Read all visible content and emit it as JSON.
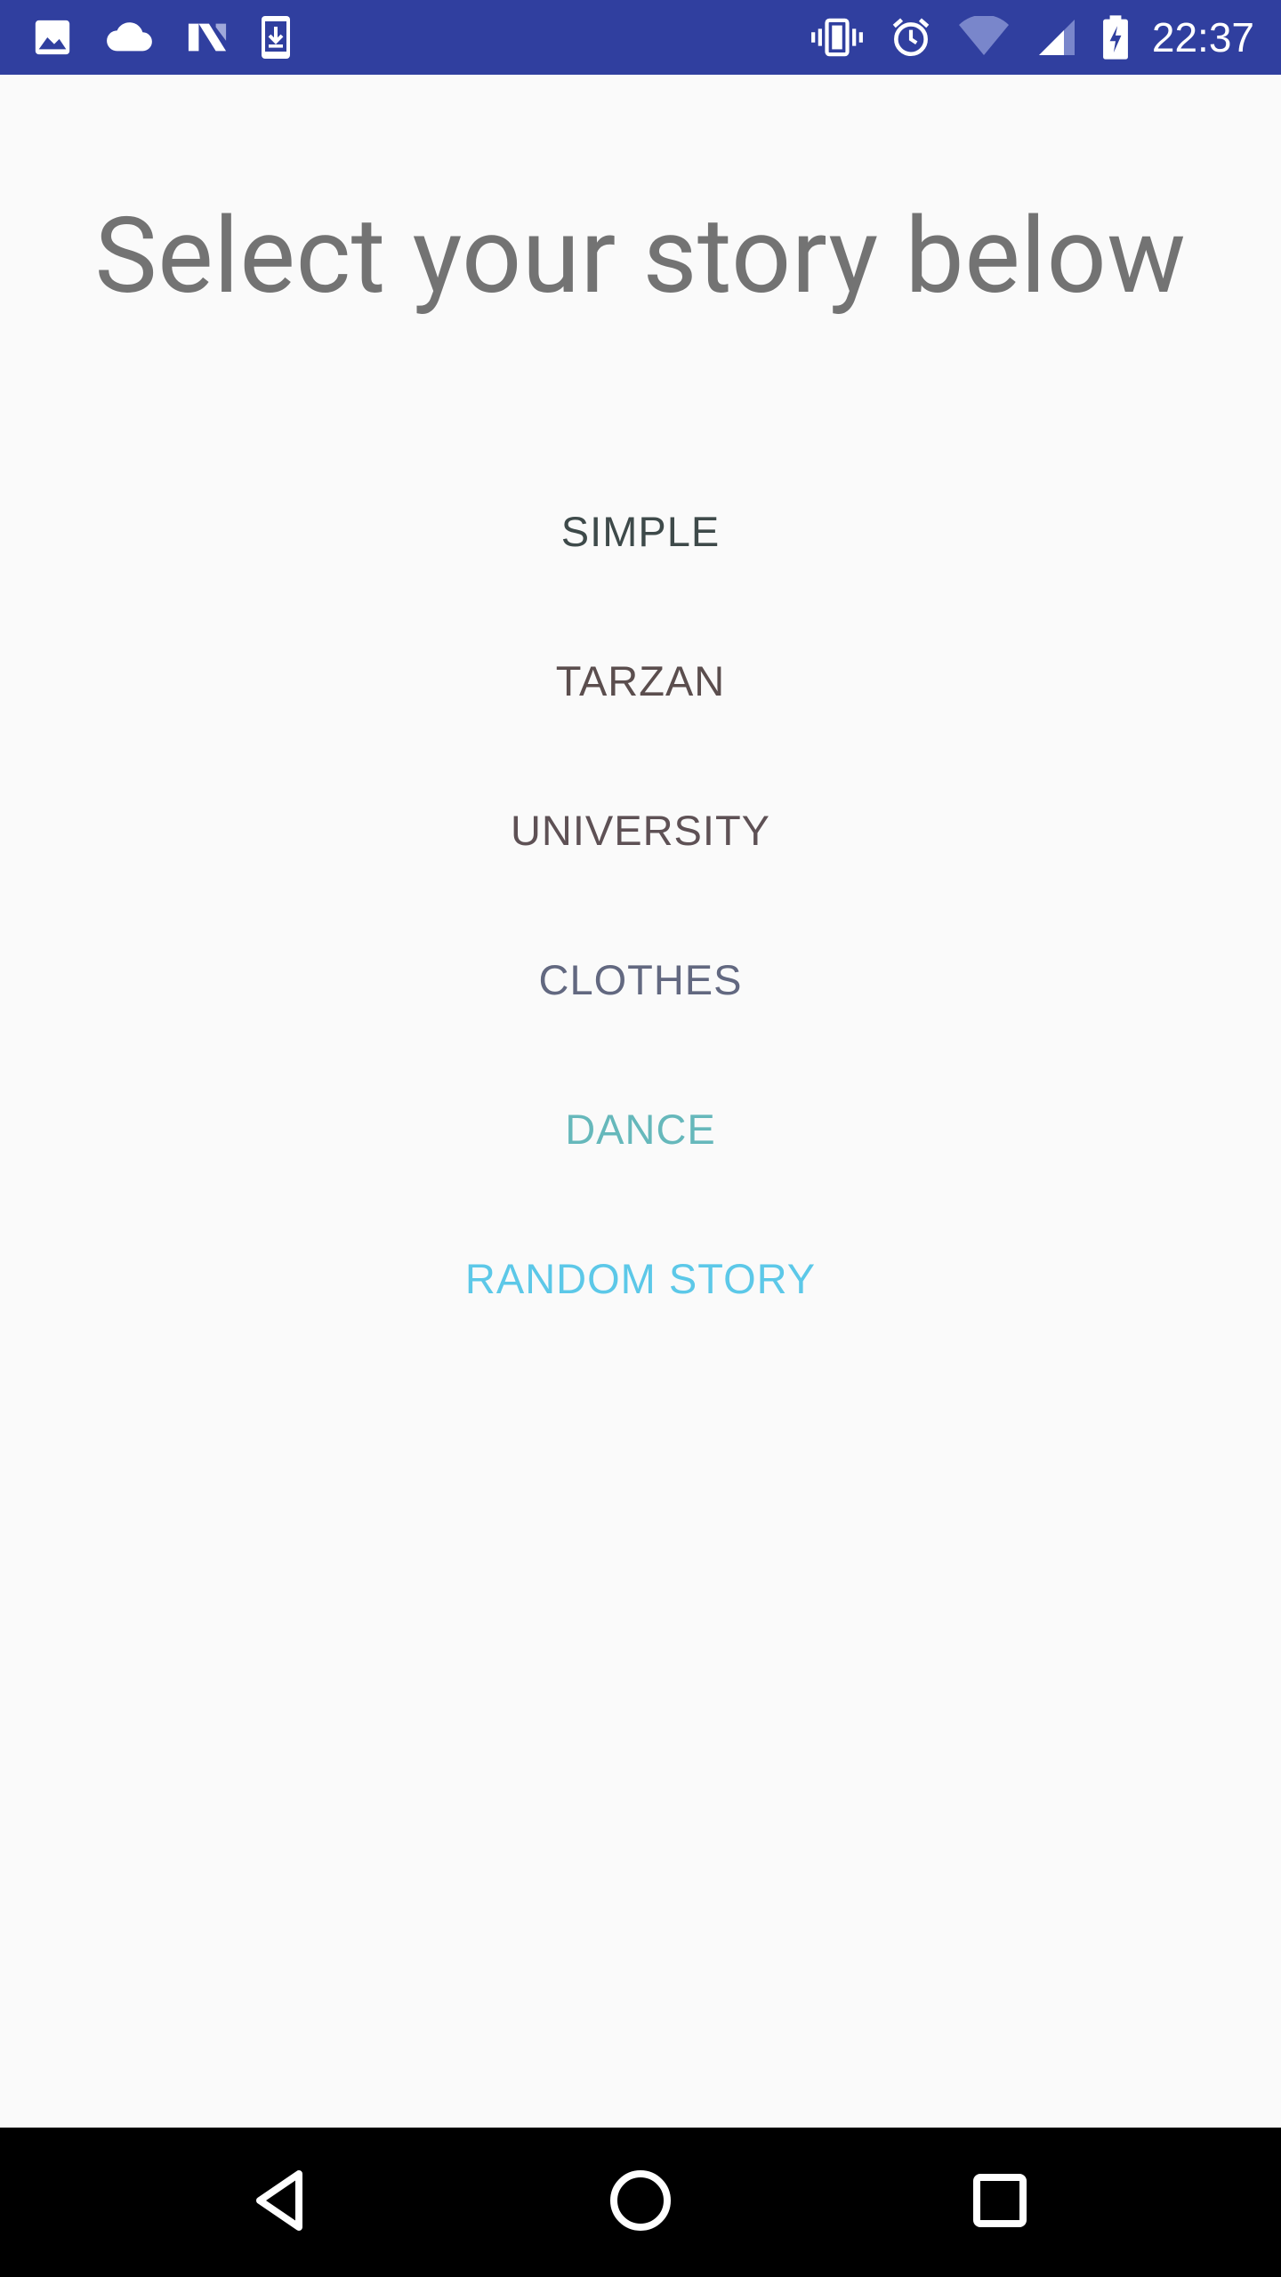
{
  "status_bar": {
    "time": "22:37",
    "left_icons": [
      "image-icon",
      "cloud-icon",
      "n-logo-icon",
      "download-phone-icon"
    ],
    "right_icons": [
      "vibrate-icon",
      "alarm-icon",
      "wifi-icon",
      "signal-icon",
      "battery-charging-icon"
    ],
    "background": "#303f9f"
  },
  "page": {
    "title": "Select your story below"
  },
  "stories": [
    {
      "label": "SIMPLE",
      "color": "#3e4a4a"
    },
    {
      "label": "TARZAN",
      "color": "#5b4e4e"
    },
    {
      "label": "UNIVERSITY",
      "color": "#5e5155"
    },
    {
      "label": "CLOTHES",
      "color": "#626880"
    },
    {
      "label": "DANCE",
      "color": "#66b8bb"
    },
    {
      "label": "RANDOM STORY",
      "color": "#5cc8e8"
    }
  ],
  "nav_bar": {
    "buttons": [
      "back-icon",
      "home-icon",
      "recents-icon"
    ]
  }
}
